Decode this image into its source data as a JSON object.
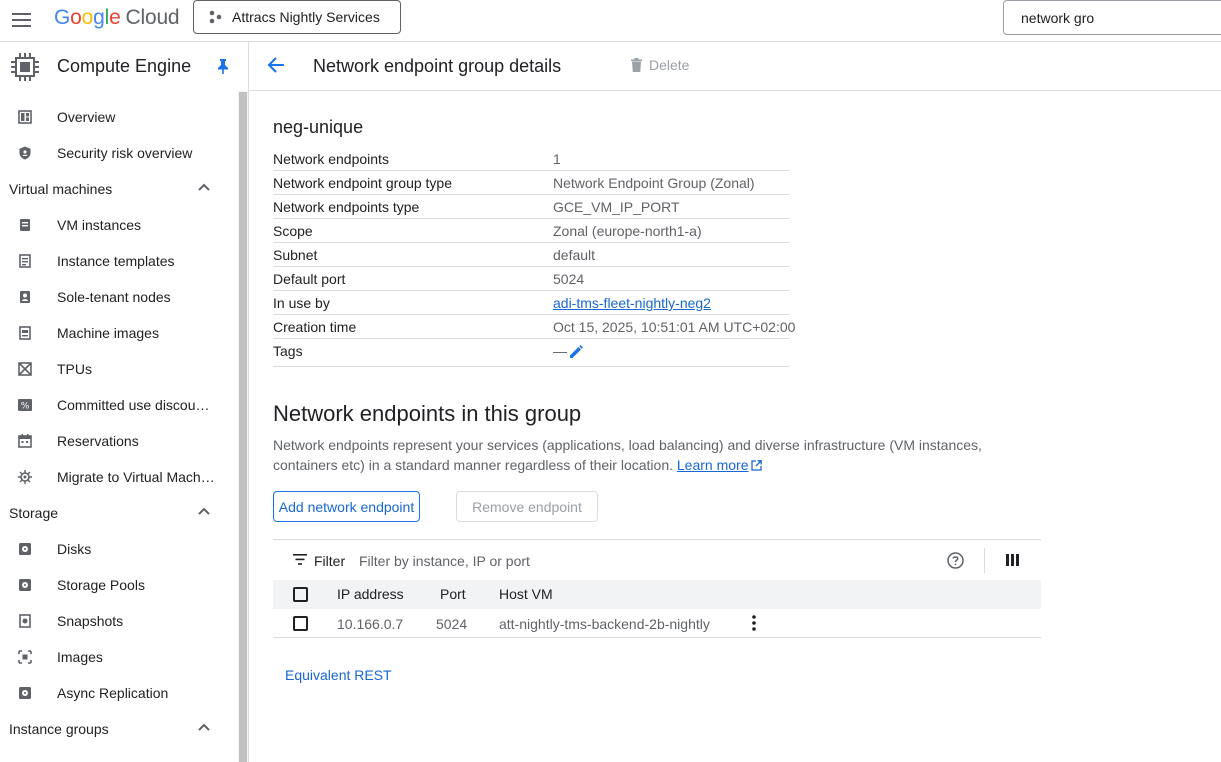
{
  "topbar": {
    "logo_letters": [
      "G",
      "o",
      "o",
      "g",
      "l",
      "e"
    ],
    "logo_cloud": "Cloud",
    "project_name": "Attracs Nightly Services",
    "search_value": "network gro"
  },
  "sidebar": {
    "product_title": "Compute Engine",
    "items": [
      {
        "type": "item",
        "label": "Overview",
        "icon": "dashboard-icon"
      },
      {
        "type": "item",
        "label": "Security risk overview",
        "icon": "shield-icon"
      },
      {
        "type": "section",
        "label": "Virtual machines"
      },
      {
        "type": "item",
        "label": "VM instances",
        "icon": "vm-instance-icon"
      },
      {
        "type": "item",
        "label": "Instance templates",
        "icon": "template-icon"
      },
      {
        "type": "item",
        "label": "Sole-tenant nodes",
        "icon": "sole-tenant-icon"
      },
      {
        "type": "item",
        "label": "Machine images",
        "icon": "machine-image-icon"
      },
      {
        "type": "item",
        "label": "TPUs",
        "icon": "tpu-icon"
      },
      {
        "type": "item",
        "label": "Committed use discou…",
        "icon": "percent-icon"
      },
      {
        "type": "item",
        "label": "Reservations",
        "icon": "calendar-icon"
      },
      {
        "type": "item",
        "label": "Migrate to Virtual Mach…",
        "icon": "migrate-icon"
      },
      {
        "type": "section",
        "label": "Storage"
      },
      {
        "type": "item",
        "label": "Disks",
        "icon": "disk-icon"
      },
      {
        "type": "item",
        "label": "Storage Pools",
        "icon": "storage-pool-icon"
      },
      {
        "type": "item",
        "label": "Snapshots",
        "icon": "snapshot-icon"
      },
      {
        "type": "item",
        "label": "Images",
        "icon": "image-icon"
      },
      {
        "type": "item",
        "label": "Async Replication",
        "icon": "replication-icon"
      },
      {
        "type": "section",
        "label": "Instance groups"
      }
    ]
  },
  "header": {
    "title": "Network endpoint group details",
    "delete_label": "Delete"
  },
  "neg": {
    "name": "neg-unique",
    "details": [
      {
        "key": "Network endpoints",
        "value": "1"
      },
      {
        "key": "Network endpoint group type",
        "value": "Network Endpoint Group (Zonal)"
      },
      {
        "key": "Network endpoints type",
        "value": "GCE_VM_IP_PORT"
      },
      {
        "key": "Scope",
        "value": "Zonal (europe-north1-a)"
      },
      {
        "key": "Subnet",
        "value": "default"
      },
      {
        "key": "Default port",
        "value": "5024"
      },
      {
        "key": "In use by",
        "value": "adi-tms-fleet-nightly-neg2"
      },
      {
        "key": "Creation time",
        "value": "Oct 15, 2025, 10:51:01 AM UTC+02:00"
      },
      {
        "key": "Tags",
        "value": "—"
      }
    ]
  },
  "endpoints": {
    "title": "Network endpoints in this group",
    "description": "Network endpoints represent your services (applications, load balancing) and diverse infrastructure (VM instances, containers etc) in a standard manner regardless of their location.",
    "learn_more": "Learn more",
    "add_button": "Add network endpoint",
    "remove_button": "Remove endpoint",
    "filter_label": "Filter",
    "filter_placeholder": "Filter by instance, IP or port",
    "columns": [
      "IP address",
      "Port",
      "Host VM"
    ],
    "rows": [
      {
        "ip": "10.166.0.7",
        "port": "5024",
        "host_vm": "att-nightly-tms-backend-2b-nightly"
      }
    ]
  },
  "footer": {
    "equivalent_rest": "Equivalent REST"
  },
  "colors": {
    "accent": "#1a73e8",
    "link": "#1967d2",
    "text": "#202124",
    "secondary_text": "#5f6368",
    "divider": "#dadce0"
  }
}
